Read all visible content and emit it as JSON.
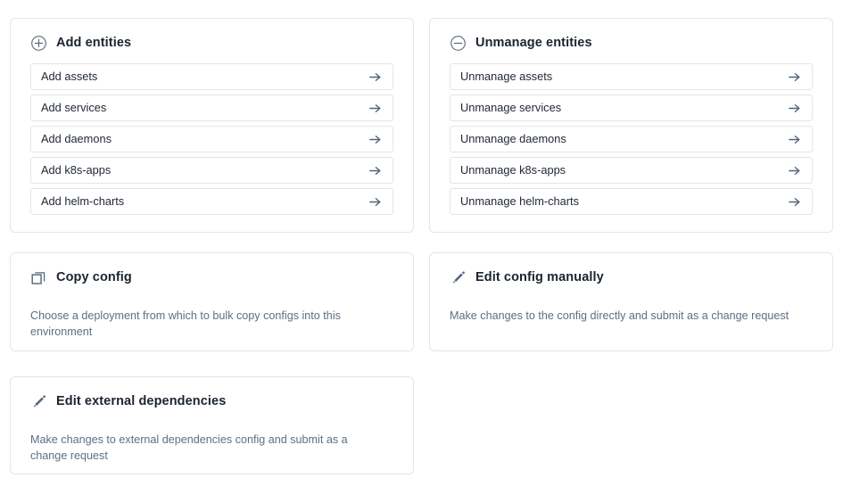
{
  "cards": {
    "add_entities": {
      "title": "Add entities",
      "icon": "plus-circle-icon",
      "items": [
        {
          "label": "Add assets",
          "icon": "arrow-right-icon"
        },
        {
          "label": "Add services",
          "icon": "arrow-right-icon"
        },
        {
          "label": "Add daemons",
          "icon": "arrow-right-icon"
        },
        {
          "label": "Add k8s-apps",
          "icon": "arrow-right-icon"
        },
        {
          "label": "Add helm-charts",
          "icon": "arrow-right-icon"
        }
      ]
    },
    "unmanage_entities": {
      "title": "Unmanage entities",
      "icon": "minus-circle-icon",
      "items": [
        {
          "label": "Unmanage assets",
          "icon": "arrow-right-icon"
        },
        {
          "label": "Unmanage services",
          "icon": "arrow-right-icon"
        },
        {
          "label": "Unmanage daemons",
          "icon": "arrow-right-icon"
        },
        {
          "label": "Unmanage k8s-apps",
          "icon": "arrow-right-icon"
        },
        {
          "label": "Unmanage helm-charts",
          "icon": "arrow-right-icon"
        }
      ]
    },
    "copy_config": {
      "title": "Copy config",
      "icon": "copy-icon",
      "description": "Choose a deployment from which to bulk copy configs into this environment"
    },
    "edit_config_manually": {
      "title": "Edit config manually",
      "icon": "pencil-icon",
      "description": "Make changes to the config directly and submit as a change request"
    },
    "edit_external_dependencies": {
      "title": "Edit external dependencies",
      "icon": "pencil-icon",
      "description": "Make changes to external dependencies config and submit as a change request"
    }
  },
  "colors": {
    "card_border": "#e3e5e9",
    "title_text": "#1b2430",
    "body_text": "#1f2733",
    "muted_text": "#5d6f84",
    "icon": "#55677c",
    "background": "#ffffff"
  }
}
